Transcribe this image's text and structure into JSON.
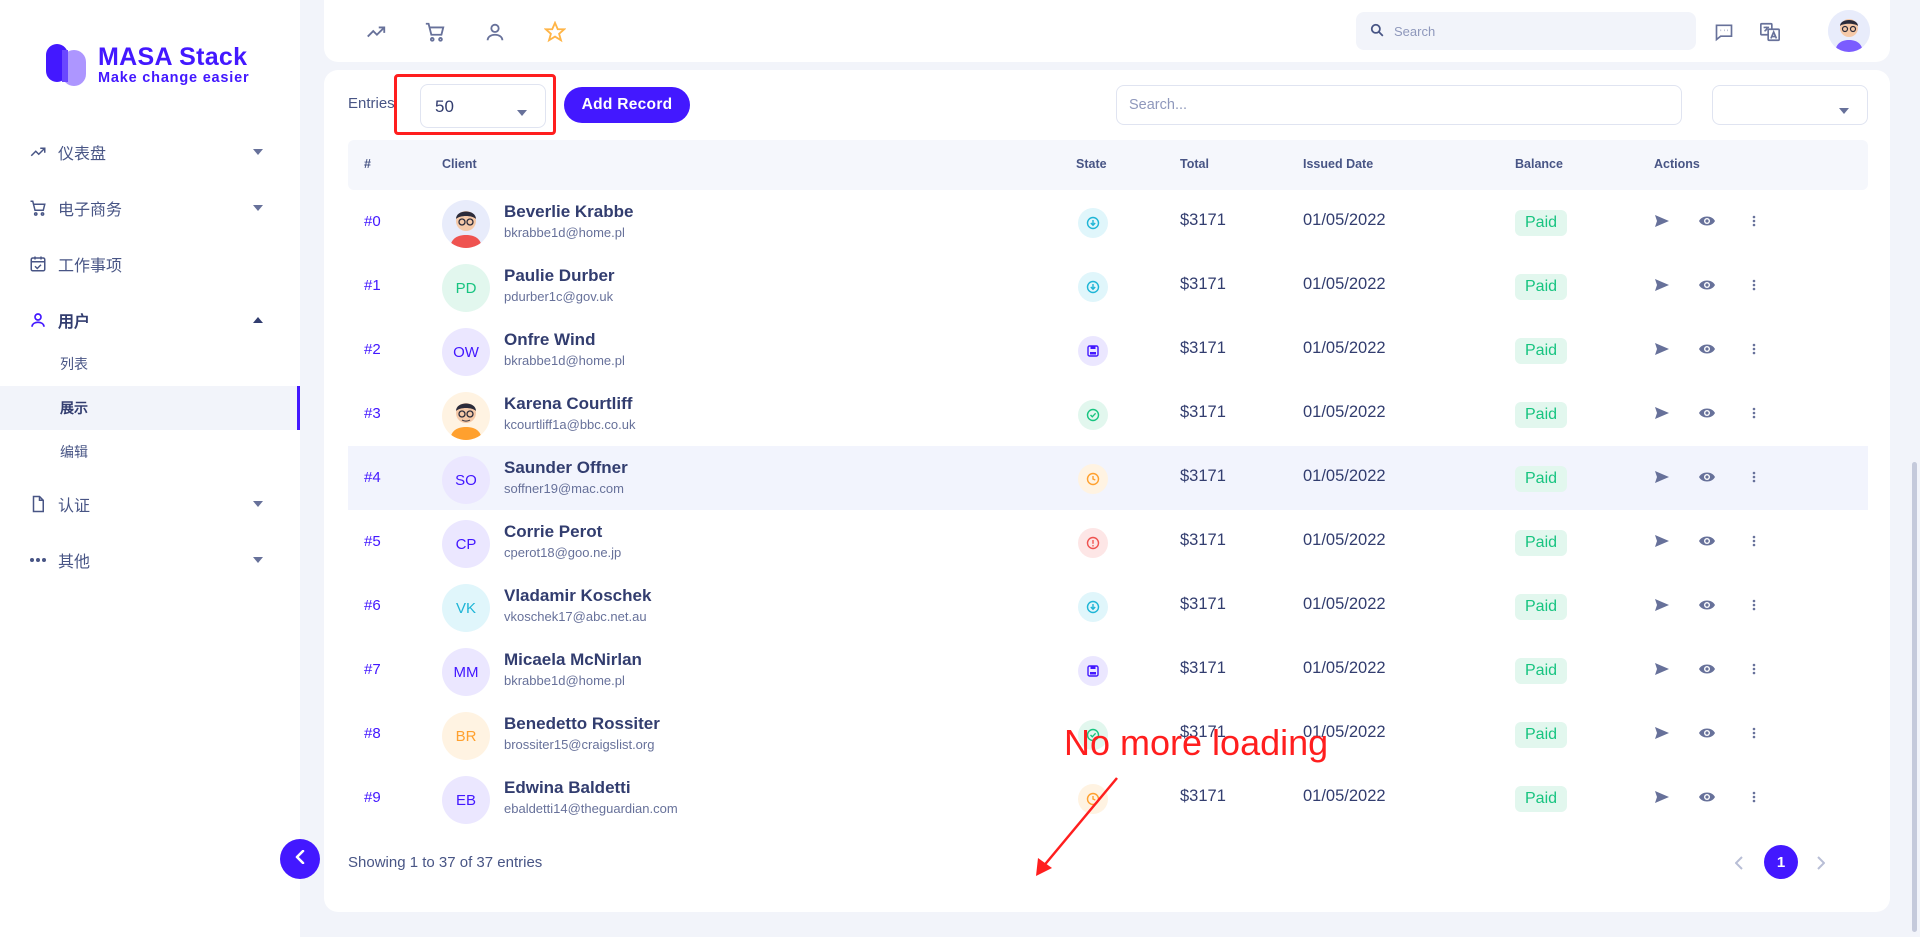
{
  "brand": {
    "title": "MASA Stack",
    "subtitle": "Make change easier",
    "accent": "#4318ff"
  },
  "sidebar": {
    "items": [
      {
        "label": "仪表盘",
        "icon": "trending-up-icon"
      },
      {
        "label": "电子商务",
        "icon": "cart-icon"
      },
      {
        "label": "工作事项",
        "icon": "calendar-check-icon"
      },
      {
        "label": "用户",
        "icon": "user-icon",
        "expanded": true,
        "children": [
          {
            "label": "列表"
          },
          {
            "label": "展示",
            "active": true
          },
          {
            "label": "编辑"
          }
        ]
      },
      {
        "label": "认证",
        "icon": "file-icon"
      },
      {
        "label": "其他",
        "icon": "dots-icon"
      }
    ]
  },
  "topbar": {
    "icons": [
      "trending-up-icon",
      "cart-icon",
      "user-icon",
      "star-icon"
    ],
    "search_placeholder": "Search"
  },
  "toolbar": {
    "entries_label": "Entries",
    "entries_value": "50",
    "add_label": "Add Record",
    "search_placeholder": "Search..."
  },
  "table": {
    "headers": [
      "#",
      "Client",
      "State",
      "Total",
      "Issued Date",
      "Balance",
      "Actions"
    ],
    "rows": [
      {
        "id": "#0",
        "initials": "",
        "avatar": "photo-man-glasses",
        "name": "Beverlie Krabbe",
        "email": "bkrabbe1d@home.pl",
        "state": "arrow-down-circle",
        "total": "$3171",
        "date": "01/05/2022",
        "balance": "Paid"
      },
      {
        "id": "#1",
        "initials": "PD",
        "avatar": "initials",
        "name": "Paulie Durber",
        "email": "pdurber1c@gov.uk",
        "state": "arrow-down-circle",
        "total": "$3171",
        "date": "01/05/2022",
        "balance": "Paid"
      },
      {
        "id": "#2",
        "initials": "OW",
        "avatar": "initials",
        "name": "Onfre Wind",
        "email": "bkrabbe1d@home.pl",
        "state": "save",
        "total": "$3171",
        "date": "01/05/2022",
        "balance": "Paid"
      },
      {
        "id": "#3",
        "initials": "",
        "avatar": "photo-man-orange",
        "name": "Karena Courtliff",
        "email": "kcourtliff1a@bbc.co.uk",
        "state": "check-circle",
        "total": "$3171",
        "date": "01/05/2022",
        "balance": "Paid"
      },
      {
        "id": "#4",
        "initials": "SO",
        "avatar": "initials",
        "name": "Saunder Offner",
        "email": "soffner19@mac.com",
        "state": "clock",
        "total": "$3171",
        "date": "01/05/2022",
        "balance": "Paid"
      },
      {
        "id": "#5",
        "initials": "CP",
        "avatar": "initials",
        "name": "Corrie Perot",
        "email": "cperot18@goo.ne.jp",
        "state": "alert-circle",
        "total": "$3171",
        "date": "01/05/2022",
        "balance": "Paid"
      },
      {
        "id": "#6",
        "initials": "VK",
        "avatar": "initials",
        "name": "Vladamir Koschek",
        "email": "vkoschek17@abc.net.au",
        "state": "arrow-down-circle",
        "total": "$3171",
        "date": "01/05/2022",
        "balance": "Paid"
      },
      {
        "id": "#7",
        "initials": "MM",
        "avatar": "initials",
        "name": "Micaela McNirlan",
        "email": "bkrabbe1d@home.pl",
        "state": "save",
        "total": "$3171",
        "date": "01/05/2022",
        "balance": "Paid"
      },
      {
        "id": "#8",
        "initials": "BR",
        "avatar": "initials",
        "name": "Benedetto Rossiter",
        "email": "brossiter15@craigslist.org",
        "state": "check-circle",
        "total": "$3171",
        "date": "01/05/2022",
        "balance": "Paid"
      },
      {
        "id": "#9",
        "initials": "EB",
        "avatar": "initials",
        "name": "Edwina Baldetti",
        "email": "ebaldetti14@theguardian.com",
        "state": "clock",
        "total": "$3171",
        "date": "01/05/2022",
        "balance": "Paid"
      }
    ]
  },
  "footer": {
    "showing": "Showing 1 to 37 of 37 entries",
    "current_page": "1"
  },
  "annotation": {
    "text": "No more loading",
    "color": "#ff1e1e"
  }
}
